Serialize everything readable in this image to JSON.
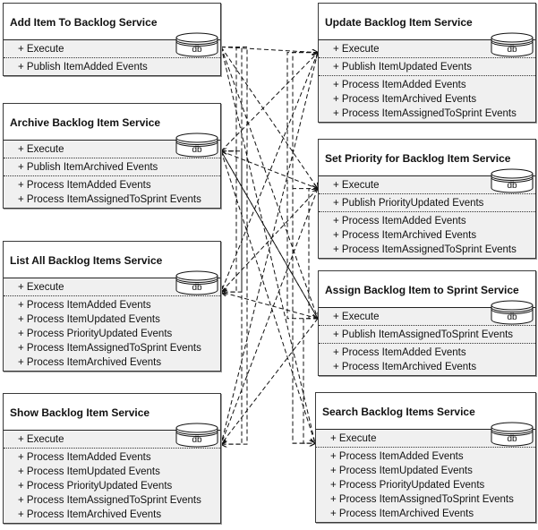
{
  "diagram": {
    "db_label": "db",
    "services": [
      {
        "id": "add",
        "title": "Add Item To Backlog Service",
        "sections": [
          [
            "+ Execute"
          ],
          [
            "+ Publish ItemAdded Events"
          ]
        ]
      },
      {
        "id": "archive",
        "title": "Archive Backlog Item Service",
        "sections": [
          [
            "+ Execute"
          ],
          [
            "+ Publish ItemArchived Events"
          ],
          [
            "+ Process ItemAdded Events",
            "+ Process ItemAssignedToSprint Events"
          ]
        ]
      },
      {
        "id": "list",
        "title": "List All Backlog Items Service",
        "sections": [
          [
            "+ Execute"
          ],
          [
            "+ Process ItemAdded Events",
            "+ Process ItemUpdated Events",
            "+ Process PriorityUpdated Events",
            "+ Process ItemAssignedToSprint Events",
            "+ Process ItemArchived Events"
          ]
        ]
      },
      {
        "id": "show",
        "title": "Show Backlog Item Service",
        "sections": [
          [
            "+ Execute"
          ],
          [
            "+ Process ItemAdded Events",
            "+ Process ItemUpdated Events",
            "+ Process PriorityUpdated Events",
            "+ Process ItemAssignedToSprint Events",
            "+ Process ItemArchived Events"
          ]
        ]
      },
      {
        "id": "update",
        "title": "Update Backlog Item Service",
        "sections": [
          [
            "+ Execute"
          ],
          [
            "+ Publish ItemUpdated Events"
          ],
          [
            "+ Process ItemAdded Events",
            "+ Process ItemArchived Events",
            "+ Process ItemAssignedToSprint Events"
          ]
        ]
      },
      {
        "id": "priority",
        "title": "Set Priority for Backlog Item Service",
        "sections": [
          [
            "+ Execute"
          ],
          [
            "+ Publish PriorityUpdated Events"
          ],
          [
            "+ Process ItemAdded Events",
            "+ Process ItemArchived Events",
            "+ Process ItemAssignedToSprint Events"
          ]
        ]
      },
      {
        "id": "assign",
        "title": "Assign Backlog Item to Sprint Service",
        "sections": [
          [
            "+ Execute"
          ],
          [
            "+ Publish ItemAssignedToSprint Events"
          ],
          [
            "+ Process ItemAdded Events",
            "+ Process ItemArchived Events"
          ]
        ]
      },
      {
        "id": "search",
        "title": "Search Backlog Items Service",
        "sections": [
          [
            "+ Execute"
          ],
          [
            "+ Process ItemAdded Events",
            "+ Process ItemUpdated Events",
            "+ Process PriorityUpdated Events",
            "+ Process ItemAssignedToSprint Events",
            "+ Process ItemArchived Events"
          ]
        ]
      }
    ],
    "event_flows": [
      {
        "from": "add",
        "to": "archive"
      },
      {
        "from": "add",
        "to": "list"
      },
      {
        "from": "add",
        "to": "show"
      },
      {
        "from": "add",
        "to": "update"
      },
      {
        "from": "add",
        "to": "priority"
      },
      {
        "from": "add",
        "to": "assign"
      },
      {
        "from": "add",
        "to": "search"
      },
      {
        "from": "update",
        "to": "list"
      },
      {
        "from": "update",
        "to": "show"
      },
      {
        "from": "update",
        "to": "search"
      },
      {
        "from": "archive",
        "to": "list"
      },
      {
        "from": "archive",
        "to": "show"
      },
      {
        "from": "archive",
        "to": "update"
      },
      {
        "from": "archive",
        "to": "priority"
      },
      {
        "from": "archive",
        "to": "assign"
      },
      {
        "from": "archive",
        "to": "search"
      },
      {
        "from": "priority",
        "to": "list"
      },
      {
        "from": "priority",
        "to": "show"
      },
      {
        "from": "priority",
        "to": "search"
      },
      {
        "from": "assign",
        "to": "archive"
      },
      {
        "from": "assign",
        "to": "list"
      },
      {
        "from": "assign",
        "to": "show"
      },
      {
        "from": "assign",
        "to": "update"
      },
      {
        "from": "assign",
        "to": "priority"
      },
      {
        "from": "assign",
        "to": "search"
      }
    ]
  }
}
